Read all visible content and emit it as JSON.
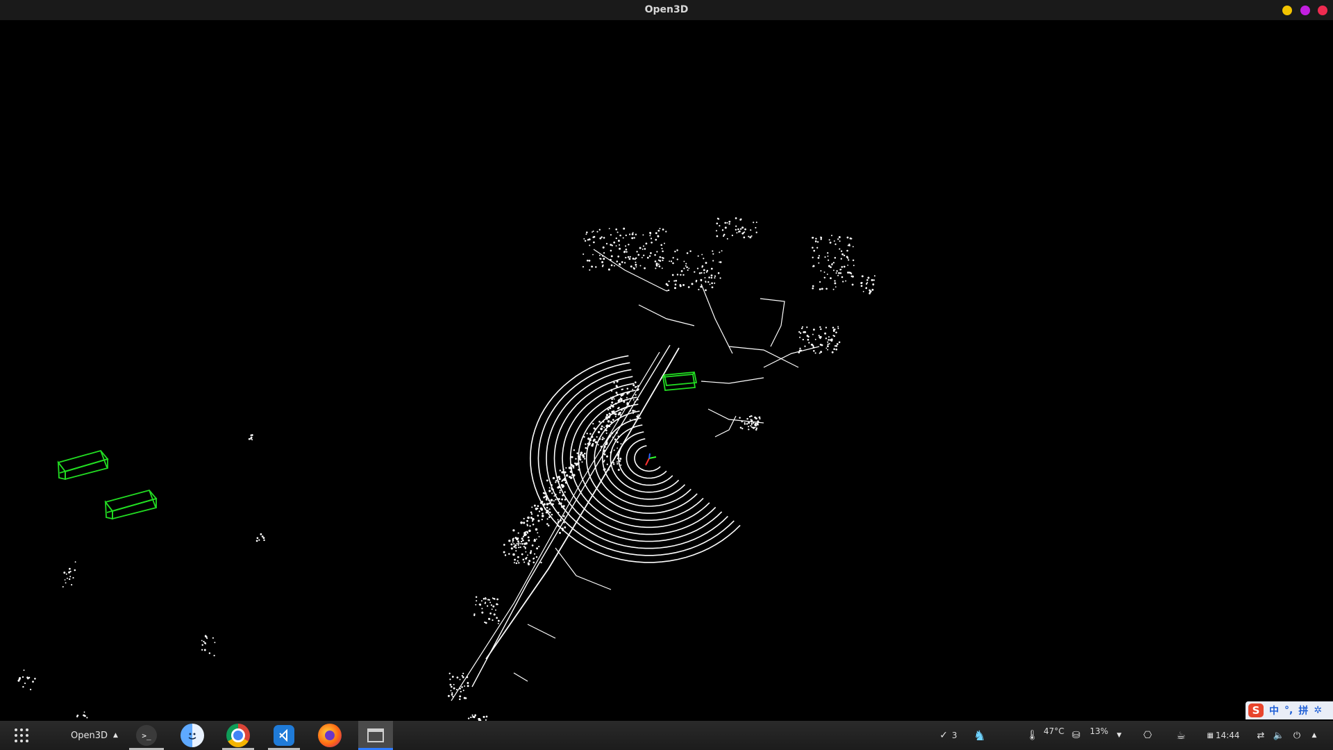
{
  "window": {
    "title": "Open3D",
    "controls": [
      {
        "name": "minimize-button",
        "color": "#f3c400"
      },
      {
        "name": "maximize-button",
        "color": "#c21fe0"
      },
      {
        "name": "close-button",
        "color": "#ef2b50"
      }
    ]
  },
  "viewer": {
    "point_color": "#ffffff",
    "box_color": "#22dd22",
    "background": "#000000"
  },
  "ime": {
    "logo": "S",
    "mode": "中",
    "punct": "°,",
    "input": "拼",
    "settings_icon": "gear-icon"
  },
  "taskbar": {
    "launcher_icon": "grid-icon",
    "active_window_label": "Open3D",
    "apps": [
      {
        "name": "terminal",
        "icon": "terminal-icon",
        "glyph": ">_"
      },
      {
        "name": "finder",
        "icon": "finder-icon"
      },
      {
        "name": "chrome",
        "icon": "chrome-icon"
      },
      {
        "name": "vscode",
        "icon": "vscode-icon"
      },
      {
        "name": "firefox",
        "icon": "firefox-icon"
      },
      {
        "name": "open3d-window",
        "icon": "window-icon"
      }
    ],
    "tray": {
      "tasks_count": "3",
      "temperature": "47°C",
      "disk_usage": "13%",
      "clock": "14:44"
    }
  }
}
